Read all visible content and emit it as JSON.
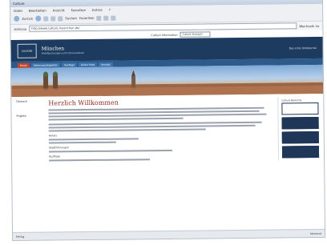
{
  "window": {
    "title": "Culture"
  },
  "menu": [
    "Datei",
    "Bearbeiten",
    "Ansicht",
    "Favoriten",
    "Extras",
    "?"
  ],
  "toolbar": {
    "back_label": "Zurück",
    "search_label": "Suchen",
    "favorites_label": "Favoriten"
  },
  "address": {
    "label": "Adresse",
    "url": "http://www.culture.muenchen.de/",
    "go_label": "Wechseln zu"
  },
  "site": {
    "topnav_label": "Culture Information",
    "topnav_select": "Culture Stuttgart",
    "logo_text": "CULTURE",
    "city_title": "München",
    "city_sub": "Hotelbuchungen und Informationen",
    "banner_right": "Das erste Hotelportal",
    "tabs": [
      "Home",
      "Sehenswürdigkeiten",
      "Ausflüge",
      "Kultur Infos",
      "Kontakt"
    ],
    "heading": "Herzlich Willkommen",
    "left_items": [
      "Deutsch",
      "English"
    ],
    "sections": [
      "Hotels",
      "Stadtführungen",
      "Ausflüge"
    ],
    "right_title": "Culture Bereiche"
  },
  "statusbar": {
    "left": "Fertig",
    "right": "Internet"
  }
}
